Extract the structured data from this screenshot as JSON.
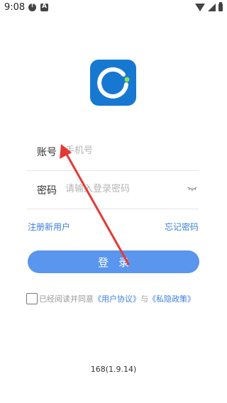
{
  "status_bar": {
    "time": "9:08"
  },
  "login": {
    "account_label": "账号",
    "account_placeholder": "手机号",
    "password_label": "密码",
    "password_placeholder": "请输入登录密码",
    "register_link": "注册新用户",
    "forgot_link": "忘记密码",
    "login_button": "登录"
  },
  "agreement": {
    "prefix": "已经阅读并同意",
    "user_agreement": "《用户协议》",
    "and": "与",
    "privacy_policy": "《私隐政策》"
  },
  "footer": {
    "version": "168(1.9.14)"
  },
  "colors": {
    "brand_blue": "#1778d2",
    "button_blue": "#5a95ee",
    "link_blue": "#3b7fe0",
    "annotation_red": "#e53935"
  }
}
